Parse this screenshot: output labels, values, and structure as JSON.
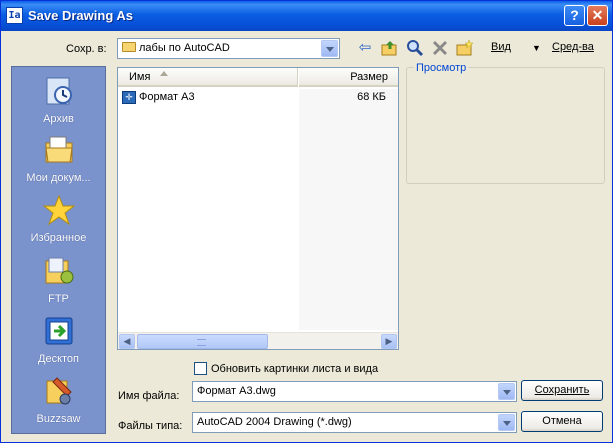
{
  "window": {
    "title": "Save Drawing As",
    "help_label": "?",
    "close_label": "✕"
  },
  "location": {
    "label": "Сохр. в:",
    "value": "лабы по AutoCAD"
  },
  "toolbar": {
    "view_label": "Вид",
    "tools_label": "Сред-ва"
  },
  "places": [
    {
      "label": "Архив",
      "icon": "history-icon"
    },
    {
      "label": "Мои докум...",
      "icon": "my-documents-icon"
    },
    {
      "label": "Избранное",
      "icon": "favorites-icon"
    },
    {
      "label": "FTP",
      "icon": "ftp-icon"
    },
    {
      "label": "Десктоп",
      "icon": "desktop-icon"
    },
    {
      "label": "Buzzsaw",
      "icon": "buzzsaw-icon"
    }
  ],
  "file_list": {
    "columns": {
      "name": "Имя",
      "size": "Размер"
    },
    "rows": [
      {
        "name": "Формат А3",
        "size": "68 КБ"
      }
    ]
  },
  "preview": {
    "label": "Просмотр"
  },
  "update_checkbox": {
    "label": "Обновить картинки листа и вида",
    "checked": false
  },
  "filename": {
    "label": "Имя файла:",
    "value": "Формат А3.dwg"
  },
  "filetype": {
    "label": "Файлы типа:",
    "value": "AutoCAD 2004 Drawing (*.dwg)"
  },
  "buttons": {
    "save": "Сохранить",
    "cancel": "Отмена"
  },
  "colors": {
    "title_bar": "#0a5fe8",
    "places_bar": "#7b93cd",
    "dialog_bg": "#ece9d8",
    "preview_label": "#0046d5"
  }
}
